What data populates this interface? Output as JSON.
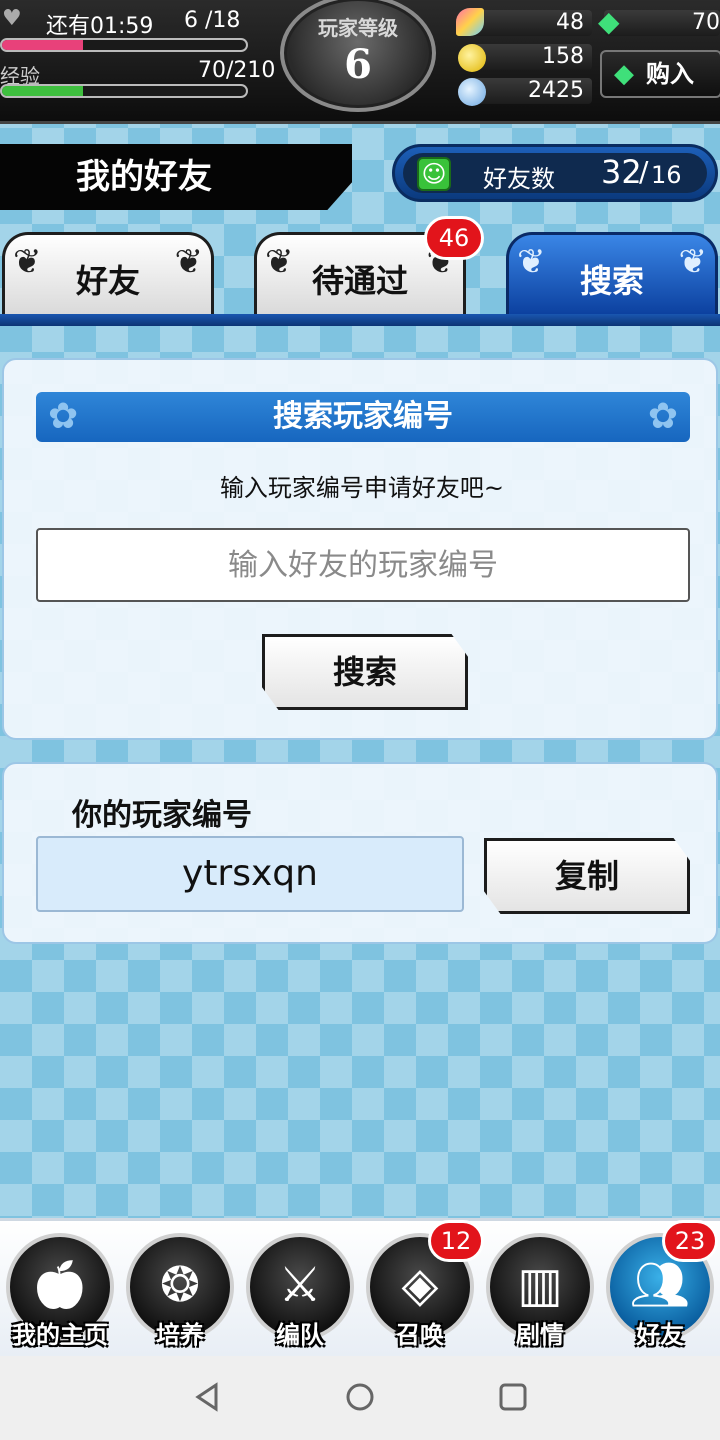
{
  "hud": {
    "stamina_text": "还有01:59",
    "stamina_value": "6 /18",
    "stamina_fraction": 0.33,
    "exp_label": "经验",
    "exp_value": "70/210",
    "exp_fraction": 0.33,
    "level_title": "玩家等级",
    "level_value": "6",
    "resources": [
      {
        "icon": "feather-icon",
        "value": "48"
      },
      {
        "icon": "coin-icon",
        "value": "158"
      },
      {
        "icon": "orb-icon",
        "value": "2425"
      }
    ],
    "gems": "70",
    "buy_label": "购入"
  },
  "header": {
    "title": "我的好友",
    "friend_count_label": "好友数",
    "friend_count": "32",
    "friend_limit": "16"
  },
  "tabs": [
    {
      "label": "好友",
      "active": false,
      "badge": ""
    },
    {
      "label": "待通过",
      "active": false,
      "badge": "46"
    },
    {
      "label": "搜索",
      "active": true,
      "badge": ""
    }
  ],
  "search": {
    "heading": "搜索玩家编号",
    "hint": "输入玩家编号申请好友吧~",
    "placeholder": "输入好友的玩家编号",
    "button_label": "搜索"
  },
  "my_id": {
    "label": "你的玩家编号",
    "value": "ytrsxqn",
    "copy_label": "复制"
  },
  "bottom_nav": [
    {
      "label": "我的主页",
      "icon": "apple-icon",
      "badge": "",
      "active": false
    },
    {
      "label": "培养",
      "icon": "gem-cluster-icon",
      "badge": "",
      "active": false
    },
    {
      "label": "编队",
      "icon": "crossed-swords-icon",
      "badge": "",
      "active": false
    },
    {
      "label": "召唤",
      "icon": "diamond-icon",
      "badge": "12",
      "active": false
    },
    {
      "label": "剧情",
      "icon": "book-icon",
      "badge": "",
      "active": false
    },
    {
      "label": "好友",
      "icon": "friends-icon",
      "badge": "23",
      "active": true
    }
  ],
  "colors": {
    "accent_blue": "#1766bf",
    "badge_red": "#e2141b",
    "stamina_pink": "#e8417a",
    "exp_green": "#3fbf3f"
  }
}
